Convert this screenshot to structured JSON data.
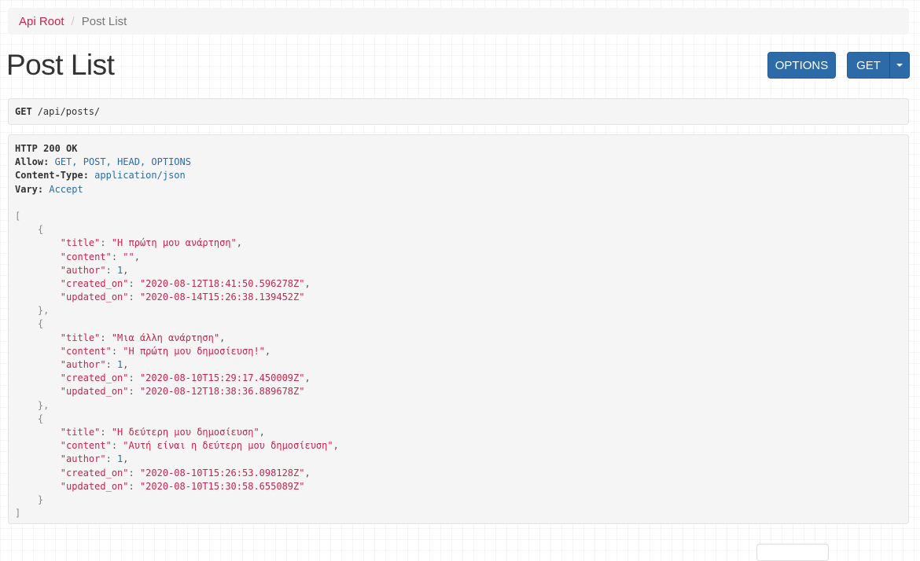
{
  "breadcrumb": {
    "root": "Api Root",
    "separator": "/",
    "current": "Post List"
  },
  "page_title": "Post List",
  "buttons": {
    "options": "OPTIONS",
    "get": "GET"
  },
  "request": {
    "method": "GET",
    "path": "/api/posts/"
  },
  "response": {
    "status": "HTTP 200 OK",
    "allow_key": "Allow:",
    "allow_value": "GET, POST, HEAD, OPTIONS",
    "content_type_key": "Content-Type:",
    "content_type_value": "application/json",
    "vary_key": "Vary:",
    "vary_value": "Accept"
  },
  "posts": [
    {
      "title": "\"Η πρώτη μου ανάρτηση\"",
      "content": "\"\"",
      "author": "1",
      "created_on": "\"2020-08-12T18:41:50.596278Z\"",
      "updated_on": "\"2020-08-14T15:26:38.139452Z\""
    },
    {
      "title": "\"Μια άλλη ανάρτηση\"",
      "content": "\"Η πρώτη μου δημοσίευση!\"",
      "author": "1",
      "created_on": "\"2020-08-10T15:29:17.450009Z\"",
      "updated_on": "\"2020-08-12T18:38:36.889678Z\""
    },
    {
      "title": "\"Η δεύτερη μου δημοσίευση\"",
      "content": "\"Αυτή είναι η δεύτερη μου δημοσίευση\"",
      "author": "1",
      "created_on": "\"2020-08-10T15:26:53.098128Z\"",
      "updated_on": "\"2020-08-10T15:30:58.655089Z\""
    }
  ],
  "keys": {
    "title": "\"title\"",
    "content": "\"content\"",
    "author": "\"author\"",
    "created_on": "\"created_on\"",
    "updated_on": "\"updated_on\""
  }
}
